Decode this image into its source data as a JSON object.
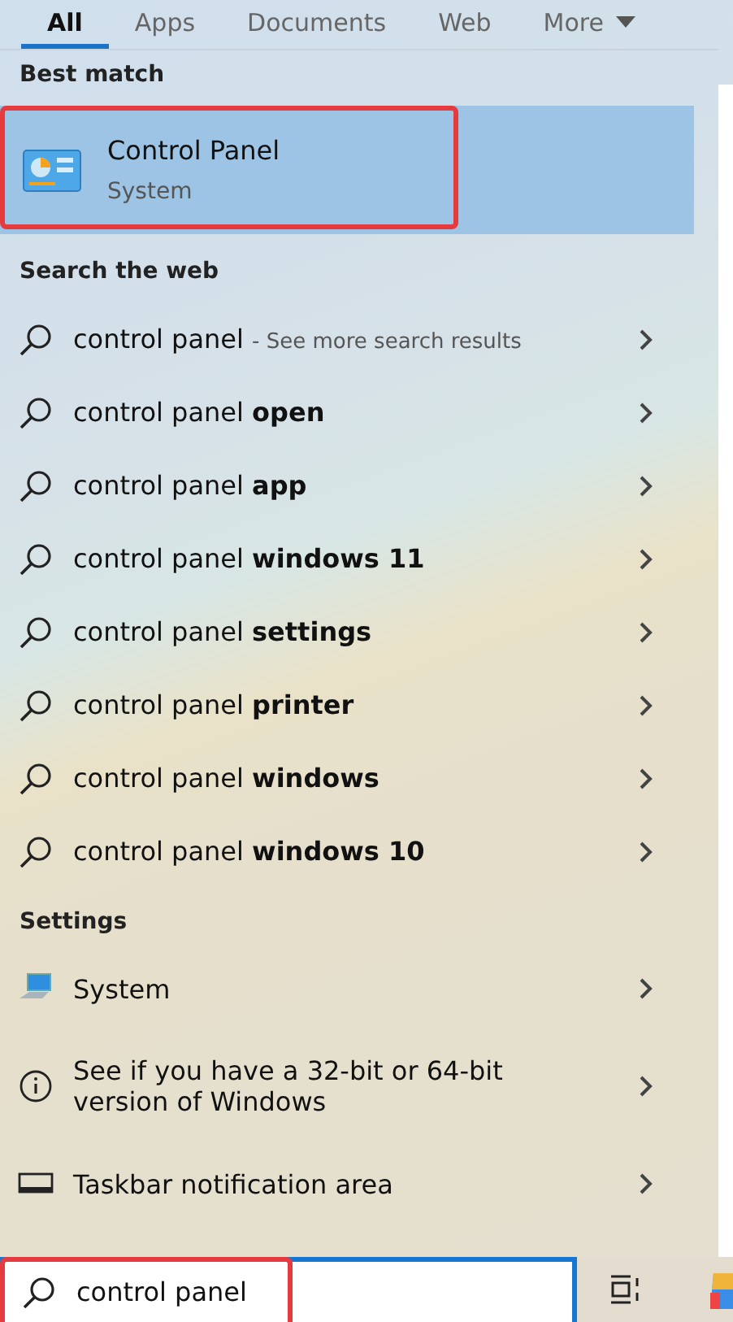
{
  "tabs": [
    {
      "label": "All",
      "selected": true
    },
    {
      "label": "Apps",
      "selected": false
    },
    {
      "label": "Documents",
      "selected": false
    },
    {
      "label": "Web",
      "selected": false
    },
    {
      "label": "More",
      "selected": false,
      "dropdown": true
    }
  ],
  "best_match": {
    "heading": "Best match",
    "title": "Control Panel",
    "subtitle": "System",
    "selected": true
  },
  "web": {
    "heading": "Search the web",
    "items": [
      {
        "text": "control panel",
        "note": "- See more search results"
      },
      {
        "text": "control panel **open**"
      },
      {
        "text": "control panel **app**"
      },
      {
        "text": "control panel **windows 11**"
      },
      {
        "text": "control panel **settings**"
      },
      {
        "text": "control panel **printer**"
      },
      {
        "text": "control panel **windows**"
      },
      {
        "text": "control panel **windows 10**"
      }
    ]
  },
  "settings": {
    "heading": "Settings",
    "items": [
      {
        "kind": "system",
        "text": "System"
      },
      {
        "kind": "info",
        "text": "See if you have a 32-bit or 64-bit version of Windows"
      },
      {
        "kind": "taskbar",
        "text": "Taskbar notification area"
      }
    ]
  },
  "search": {
    "value": "control panel"
  }
}
